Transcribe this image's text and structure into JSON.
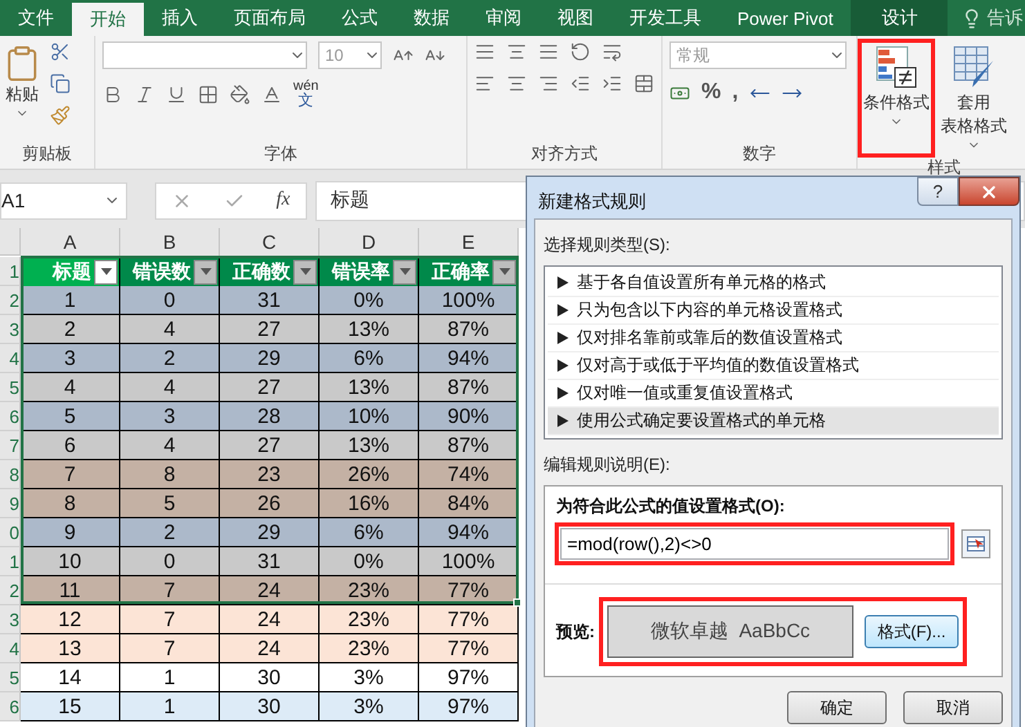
{
  "ribbon": {
    "tabs": [
      {
        "label": "文件",
        "kind": "file",
        "selected": false
      },
      {
        "label": "开始",
        "kind": "normal",
        "selected": true
      },
      {
        "label": "插入",
        "kind": "normal",
        "selected": false
      },
      {
        "label": "页面布局",
        "kind": "normal",
        "selected": false
      },
      {
        "label": "公式",
        "kind": "normal",
        "selected": false
      },
      {
        "label": "数据",
        "kind": "normal",
        "selected": false
      },
      {
        "label": "审阅",
        "kind": "normal",
        "selected": false
      },
      {
        "label": "视图",
        "kind": "normal",
        "selected": false
      },
      {
        "label": "开发工具",
        "kind": "normal",
        "selected": false
      },
      {
        "label": "Power Pivot",
        "kind": "normal",
        "selected": false
      },
      {
        "label": "设计",
        "kind": "contextual",
        "selected": false
      }
    ],
    "tell_me": "告诉",
    "clipboard": {
      "paste": "粘贴",
      "label": "剪贴板"
    },
    "font": {
      "size": "10",
      "phonetic": "wén",
      "phonetic_char": "文",
      "label": "字体"
    },
    "alignment": {
      "label": "对齐方式"
    },
    "number": {
      "format": "常规",
      "percent": "%",
      "comma": ",",
      "label": "数字"
    },
    "styles": {
      "label": "样式",
      "buttons": [
        {
          "kind": "conditional",
          "lines": [
            "条件格式"
          ],
          "highlighted": true
        },
        {
          "kind": "table",
          "lines": [
            "套用",
            "表格格式"
          ],
          "highlighted": false
        }
      ]
    }
  },
  "formula_bar": {
    "name_box": "A1",
    "fx": "fx",
    "formula": "标题"
  },
  "sheet": {
    "columns": [
      "A",
      "B",
      "C",
      "D",
      "E"
    ],
    "row_numbers": [
      "1",
      "2",
      "3",
      "4",
      "5",
      "6",
      "7",
      "8",
      "9",
      "0",
      "1",
      "2",
      "3",
      "4",
      "5",
      "6"
    ],
    "header": [
      {
        "label": "标题",
        "selected": true
      },
      {
        "label": "错误数",
        "selected": false
      },
      {
        "label": "正确数",
        "selected": false
      },
      {
        "label": "错误率",
        "selected": false
      },
      {
        "label": "正确率",
        "selected": false
      }
    ],
    "rows": [
      {
        "cells": [
          "1",
          "0",
          "31",
          "0%",
          "100%"
        ],
        "color": "#acb9ca"
      },
      {
        "cells": [
          "2",
          "4",
          "27",
          "13%",
          "87%"
        ],
        "color": "#c9c9c9"
      },
      {
        "cells": [
          "3",
          "2",
          "29",
          "6%",
          "94%"
        ],
        "color": "#acb9ca"
      },
      {
        "cells": [
          "4",
          "4",
          "27",
          "13%",
          "87%"
        ],
        "color": "#c9c9c9"
      },
      {
        "cells": [
          "5",
          "3",
          "28",
          "10%",
          "90%"
        ],
        "color": "#acb9ca"
      },
      {
        "cells": [
          "6",
          "4",
          "27",
          "13%",
          "87%"
        ],
        "color": "#c9c9c9"
      },
      {
        "cells": [
          "7",
          "8",
          "23",
          "26%",
          "74%"
        ],
        "color": "#c4b1a4"
      },
      {
        "cells": [
          "8",
          "5",
          "26",
          "16%",
          "84%"
        ],
        "color": "#c4b1a4"
      },
      {
        "cells": [
          "9",
          "2",
          "29",
          "6%",
          "94%"
        ],
        "color": "#acb9ca"
      },
      {
        "cells": [
          "10",
          "0",
          "31",
          "0%",
          "100%"
        ],
        "color": "#c9c9c9"
      },
      {
        "cells": [
          "11",
          "7",
          "24",
          "23%",
          "77%"
        ],
        "color": "#c4b1a4"
      },
      {
        "cells": [
          "12",
          "7",
          "24",
          "23%",
          "77%"
        ],
        "color": "#fce4d6"
      },
      {
        "cells": [
          "13",
          "7",
          "24",
          "23%",
          "77%"
        ],
        "color": "#fce4d6"
      },
      {
        "cells": [
          "14",
          "1",
          "30",
          "3%",
          "97%"
        ],
        "color": "#ffffff"
      },
      {
        "cells": [
          "15",
          "1",
          "30",
          "3%",
          "97%"
        ],
        "color": "#ddebf7"
      }
    ]
  },
  "dialog": {
    "title": "新建格式规则",
    "help": "?",
    "rule_type_label": "选择规则类型(S):",
    "rule_types": [
      {
        "label": "基于各自值设置所有单元格的格式",
        "selected": false
      },
      {
        "label": "只为包含以下内容的单元格设置格式",
        "selected": false
      },
      {
        "label": "仅对排名靠前或靠后的数值设置格式",
        "selected": false
      },
      {
        "label": "仅对高于或低于平均值的数值设置格式",
        "selected": false
      },
      {
        "label": "仅对唯一值或重复值设置格式",
        "selected": false
      },
      {
        "label": "使用公式确定要设置格式的单元格",
        "selected": true
      }
    ],
    "edit_label": "编辑规则说明(E):",
    "formula_label": "为符合此公式的值设置格式(O):",
    "formula": "=mod(row(),2)<>0",
    "formula_highlighted": true,
    "preview_label": "预览:",
    "preview_text": "微软卓越  AaBbCc",
    "format_button": "格式(F)...",
    "preview_highlighted": true,
    "buttons": [
      "确定",
      "取消"
    ]
  }
}
